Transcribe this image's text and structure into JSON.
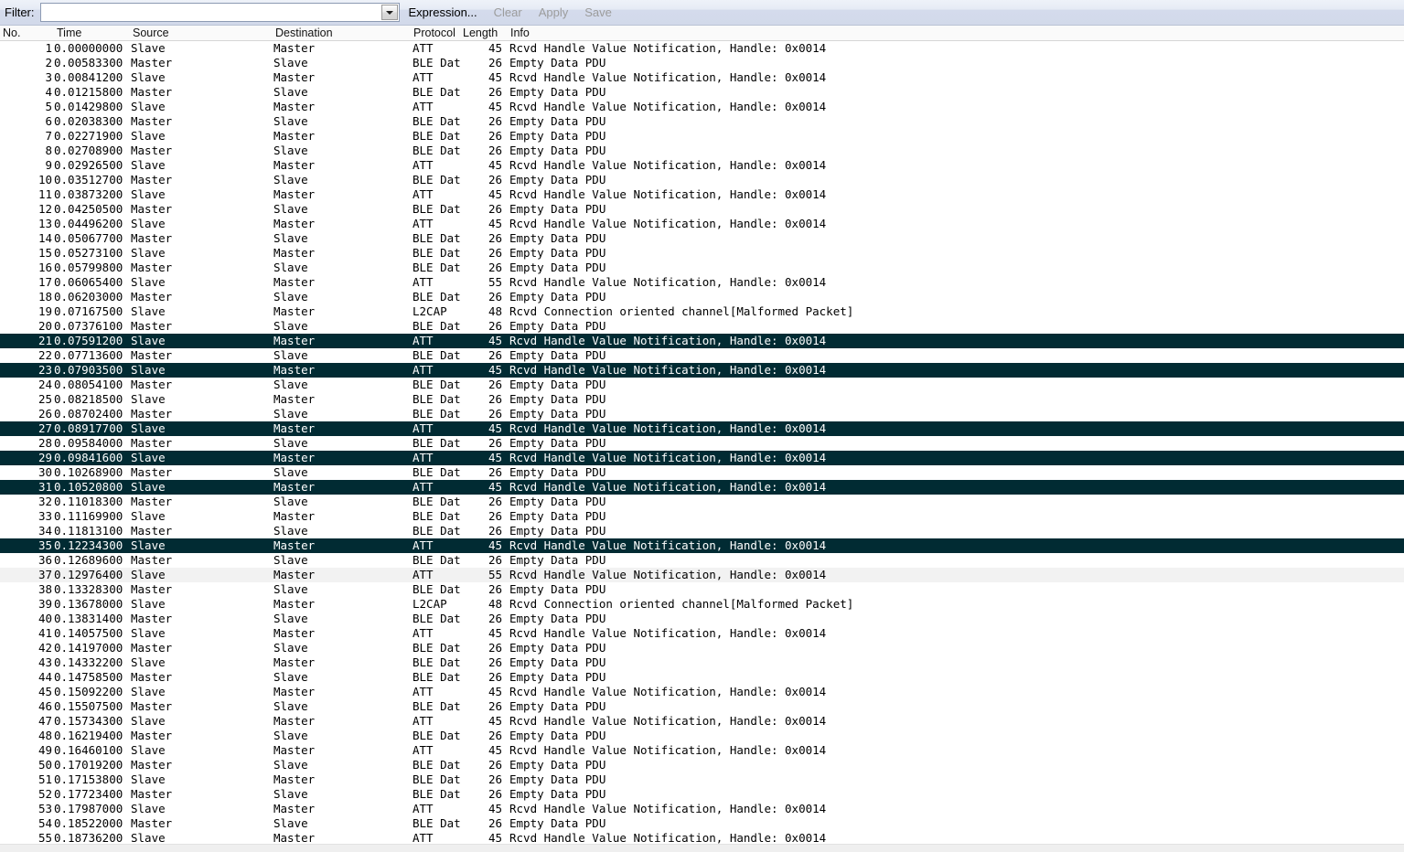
{
  "toolbar": {
    "filter_label": "Filter:",
    "filter_value": "",
    "filter_placeholder": "",
    "dropdown_icon": "chevron-down-icon",
    "expression_label": "Expression...",
    "clear_label": "Clear",
    "apply_label": "Apply",
    "save_label": "Save"
  },
  "columns": {
    "no": "No.",
    "time": "Time",
    "source": "Source",
    "destination": "Destination",
    "protocol": "Protocol",
    "length": "Length",
    "info": "Info"
  },
  "colors": {
    "selected_row_bg": "#012B33",
    "selected_row_fg": "#FFFFFF",
    "alt_row_bg": "#F2F2F2",
    "row_bg": "#FFFFFF",
    "toolbar_bg": "#D4DBEC",
    "header_bg": "#FAFAFA"
  },
  "packets": [
    {
      "no": "1",
      "time": "0.00000000",
      "src": "Slave",
      "dst": "Master",
      "proto": "ATT",
      "len": "45",
      "info": "Rcvd Handle Value Notification, Handle: 0x0014",
      "style": ""
    },
    {
      "no": "2",
      "time": "0.00583300",
      "src": "Master",
      "dst": "Slave",
      "proto": "BLE Dat",
      "len": "26",
      "info": "Empty Data PDU",
      "style": ""
    },
    {
      "no": "3",
      "time": "0.00841200",
      "src": "Slave",
      "dst": "Master",
      "proto": "ATT",
      "len": "45",
      "info": "Rcvd Handle Value Notification, Handle: 0x0014",
      "style": ""
    },
    {
      "no": "4",
      "time": "0.01215800",
      "src": "Master",
      "dst": "Slave",
      "proto": "BLE Dat",
      "len": "26",
      "info": "Empty Data PDU",
      "style": ""
    },
    {
      "no": "5",
      "time": "0.01429800",
      "src": "Slave",
      "dst": "Master",
      "proto": "ATT",
      "len": "45",
      "info": "Rcvd Handle Value Notification, Handle: 0x0014",
      "style": ""
    },
    {
      "no": "6",
      "time": "0.02038300",
      "src": "Master",
      "dst": "Slave",
      "proto": "BLE Dat",
      "len": "26",
      "info": "Empty Data PDU",
      "style": ""
    },
    {
      "no": "7",
      "time": "0.02271900",
      "src": "Slave",
      "dst": "Master",
      "proto": "BLE Dat",
      "len": "26",
      "info": "Empty Data PDU",
      "style": ""
    },
    {
      "no": "8",
      "time": "0.02708900",
      "src": "Master",
      "dst": "Slave",
      "proto": "BLE Dat",
      "len": "26",
      "info": "Empty Data PDU",
      "style": ""
    },
    {
      "no": "9",
      "time": "0.02926500",
      "src": "Slave",
      "dst": "Master",
      "proto": "ATT",
      "len": "45",
      "info": "Rcvd Handle Value Notification, Handle: 0x0014",
      "style": ""
    },
    {
      "no": "10",
      "time": "0.03512700",
      "src": "Master",
      "dst": "Slave",
      "proto": "BLE Dat",
      "len": "26",
      "info": "Empty Data PDU",
      "style": ""
    },
    {
      "no": "11",
      "time": "0.03873200",
      "src": "Slave",
      "dst": "Master",
      "proto": "ATT",
      "len": "45",
      "info": "Rcvd Handle Value Notification, Handle: 0x0014",
      "style": ""
    },
    {
      "no": "12",
      "time": "0.04250500",
      "src": "Master",
      "dst": "Slave",
      "proto": "BLE Dat",
      "len": "26",
      "info": "Empty Data PDU",
      "style": ""
    },
    {
      "no": "13",
      "time": "0.04496200",
      "src": "Slave",
      "dst": "Master",
      "proto": "ATT",
      "len": "45",
      "info": "Rcvd Handle Value Notification, Handle: 0x0014",
      "style": ""
    },
    {
      "no": "14",
      "time": "0.05067700",
      "src": "Master",
      "dst": "Slave",
      "proto": "BLE Dat",
      "len": "26",
      "info": "Empty Data PDU",
      "style": ""
    },
    {
      "no": "15",
      "time": "0.05273100",
      "src": "Slave",
      "dst": "Master",
      "proto": "BLE Dat",
      "len": "26",
      "info": "Empty Data PDU",
      "style": ""
    },
    {
      "no": "16",
      "time": "0.05799800",
      "src": "Master",
      "dst": "Slave",
      "proto": "BLE Dat",
      "len": "26",
      "info": "Empty Data PDU",
      "style": ""
    },
    {
      "no": "17",
      "time": "0.06065400",
      "src": "Slave",
      "dst": "Master",
      "proto": "ATT",
      "len": "55",
      "info": "Rcvd Handle Value Notification, Handle: 0x0014",
      "style": ""
    },
    {
      "no": "18",
      "time": "0.06203000",
      "src": "Master",
      "dst": "Slave",
      "proto": "BLE Dat",
      "len": "26",
      "info": "Empty Data PDU",
      "style": ""
    },
    {
      "no": "19",
      "time": "0.07167500",
      "src": "Slave",
      "dst": "Master",
      "proto": "L2CAP",
      "len": "48",
      "info": "Rcvd Connection oriented channel[Malformed Packet]",
      "style": ""
    },
    {
      "no": "20",
      "time": "0.07376100",
      "src": "Master",
      "dst": "Slave",
      "proto": "BLE Dat",
      "len": "26",
      "info": "Empty Data PDU",
      "style": ""
    },
    {
      "no": "21",
      "time": "0.07591200",
      "src": "Slave",
      "dst": "Master",
      "proto": "ATT",
      "len": "45",
      "info": "Rcvd Handle Value Notification, Handle: 0x0014",
      "style": "sel"
    },
    {
      "no": "22",
      "time": "0.07713600",
      "src": "Master",
      "dst": "Slave",
      "proto": "BLE Dat",
      "len": "26",
      "info": "Empty Data PDU",
      "style": ""
    },
    {
      "no": "23",
      "time": "0.07903500",
      "src": "Slave",
      "dst": "Master",
      "proto": "ATT",
      "len": "45",
      "info": "Rcvd Handle Value Notification, Handle: 0x0014",
      "style": "sel"
    },
    {
      "no": "24",
      "time": "0.08054100",
      "src": "Master",
      "dst": "Slave",
      "proto": "BLE Dat",
      "len": "26",
      "info": "Empty Data PDU",
      "style": ""
    },
    {
      "no": "25",
      "time": "0.08218500",
      "src": "Slave",
      "dst": "Master",
      "proto": "BLE Dat",
      "len": "26",
      "info": "Empty Data PDU",
      "style": ""
    },
    {
      "no": "26",
      "time": "0.08702400",
      "src": "Master",
      "dst": "Slave",
      "proto": "BLE Dat",
      "len": "26",
      "info": "Empty Data PDU",
      "style": ""
    },
    {
      "no": "27",
      "time": "0.08917700",
      "src": "Slave",
      "dst": "Master",
      "proto": "ATT",
      "len": "45",
      "info": "Rcvd Handle Value Notification, Handle: 0x0014",
      "style": "sel"
    },
    {
      "no": "28",
      "time": "0.09584000",
      "src": "Master",
      "dst": "Slave",
      "proto": "BLE Dat",
      "len": "26",
      "info": "Empty Data PDU",
      "style": ""
    },
    {
      "no": "29",
      "time": "0.09841600",
      "src": "Slave",
      "dst": "Master",
      "proto": "ATT",
      "len": "45",
      "info": "Rcvd Handle Value Notification, Handle: 0x0014",
      "style": "sel"
    },
    {
      "no": "30",
      "time": "0.10268900",
      "src": "Master",
      "dst": "Slave",
      "proto": "BLE Dat",
      "len": "26",
      "info": "Empty Data PDU",
      "style": ""
    },
    {
      "no": "31",
      "time": "0.10520800",
      "src": "Slave",
      "dst": "Master",
      "proto": "ATT",
      "len": "45",
      "info": "Rcvd Handle Value Notification, Handle: 0x0014",
      "style": "sel"
    },
    {
      "no": "32",
      "time": "0.11018300",
      "src": "Master",
      "dst": "Slave",
      "proto": "BLE Dat",
      "len": "26",
      "info": "Empty Data PDU",
      "style": ""
    },
    {
      "no": "33",
      "time": "0.11169900",
      "src": "Slave",
      "dst": "Master",
      "proto": "BLE Dat",
      "len": "26",
      "info": "Empty Data PDU",
      "style": ""
    },
    {
      "no": "34",
      "time": "0.11813100",
      "src": "Master",
      "dst": "Slave",
      "proto": "BLE Dat",
      "len": "26",
      "info": "Empty Data PDU",
      "style": ""
    },
    {
      "no": "35",
      "time": "0.12234300",
      "src": "Slave",
      "dst": "Master",
      "proto": "ATT",
      "len": "45",
      "info": "Rcvd Handle Value Notification, Handle: 0x0014",
      "style": "sel"
    },
    {
      "no": "36",
      "time": "0.12689600",
      "src": "Master",
      "dst": "Slave",
      "proto": "BLE Dat",
      "len": "26",
      "info": "Empty Data PDU",
      "style": ""
    },
    {
      "no": "37",
      "time": "0.12976400",
      "src": "Slave",
      "dst": "Master",
      "proto": "ATT",
      "len": "55",
      "info": "Rcvd Handle Value Notification, Handle: 0x0014",
      "style": "alt"
    },
    {
      "no": "38",
      "time": "0.13328300",
      "src": "Master",
      "dst": "Slave",
      "proto": "BLE Dat",
      "len": "26",
      "info": "Empty Data PDU",
      "style": ""
    },
    {
      "no": "39",
      "time": "0.13678000",
      "src": "Slave",
      "dst": "Master",
      "proto": "L2CAP",
      "len": "48",
      "info": "Rcvd Connection oriented channel[Malformed Packet]",
      "style": ""
    },
    {
      "no": "40",
      "time": "0.13831400",
      "src": "Master",
      "dst": "Slave",
      "proto": "BLE Dat",
      "len": "26",
      "info": "Empty Data PDU",
      "style": ""
    },
    {
      "no": "41",
      "time": "0.14057500",
      "src": "Slave",
      "dst": "Master",
      "proto": "ATT",
      "len": "45",
      "info": "Rcvd Handle Value Notification, Handle: 0x0014",
      "style": ""
    },
    {
      "no": "42",
      "time": "0.14197000",
      "src": "Master",
      "dst": "Slave",
      "proto": "BLE Dat",
      "len": "26",
      "info": "Empty Data PDU",
      "style": ""
    },
    {
      "no": "43",
      "time": "0.14332200",
      "src": "Slave",
      "dst": "Master",
      "proto": "BLE Dat",
      "len": "26",
      "info": "Empty Data PDU",
      "style": ""
    },
    {
      "no": "44",
      "time": "0.14758500",
      "src": "Master",
      "dst": "Slave",
      "proto": "BLE Dat",
      "len": "26",
      "info": "Empty Data PDU",
      "style": ""
    },
    {
      "no": "45",
      "time": "0.15092200",
      "src": "Slave",
      "dst": "Master",
      "proto": "ATT",
      "len": "45",
      "info": "Rcvd Handle Value Notification, Handle: 0x0014",
      "style": ""
    },
    {
      "no": "46",
      "time": "0.15507500",
      "src": "Master",
      "dst": "Slave",
      "proto": "BLE Dat",
      "len": "26",
      "info": "Empty Data PDU",
      "style": ""
    },
    {
      "no": "47",
      "time": "0.15734300",
      "src": "Slave",
      "dst": "Master",
      "proto": "ATT",
      "len": "45",
      "info": "Rcvd Handle Value Notification, Handle: 0x0014",
      "style": ""
    },
    {
      "no": "48",
      "time": "0.16219400",
      "src": "Master",
      "dst": "Slave",
      "proto": "BLE Dat",
      "len": "26",
      "info": "Empty Data PDU",
      "style": ""
    },
    {
      "no": "49",
      "time": "0.16460100",
      "src": "Slave",
      "dst": "Master",
      "proto": "ATT",
      "len": "45",
      "info": "Rcvd Handle Value Notification, Handle: 0x0014",
      "style": ""
    },
    {
      "no": "50",
      "time": "0.17019200",
      "src": "Master",
      "dst": "Slave",
      "proto": "BLE Dat",
      "len": "26",
      "info": "Empty Data PDU",
      "style": ""
    },
    {
      "no": "51",
      "time": "0.17153800",
      "src": "Slave",
      "dst": "Master",
      "proto": "BLE Dat",
      "len": "26",
      "info": "Empty Data PDU",
      "style": ""
    },
    {
      "no": "52",
      "time": "0.17723400",
      "src": "Master",
      "dst": "Slave",
      "proto": "BLE Dat",
      "len": "26",
      "info": "Empty Data PDU",
      "style": ""
    },
    {
      "no": "53",
      "time": "0.17987000",
      "src": "Slave",
      "dst": "Master",
      "proto": "ATT",
      "len": "45",
      "info": "Rcvd Handle Value Notification, Handle: 0x0014",
      "style": ""
    },
    {
      "no": "54",
      "time": "0.18522000",
      "src": "Master",
      "dst": "Slave",
      "proto": "BLE Dat",
      "len": "26",
      "info": "Empty Data PDU",
      "style": ""
    },
    {
      "no": "55",
      "time": "0.18736200",
      "src": "Slave",
      "dst": "Master",
      "proto": "ATT",
      "len": "45",
      "info": "Rcvd Handle Value Notification, Handle: 0x0014",
      "style": ""
    }
  ]
}
